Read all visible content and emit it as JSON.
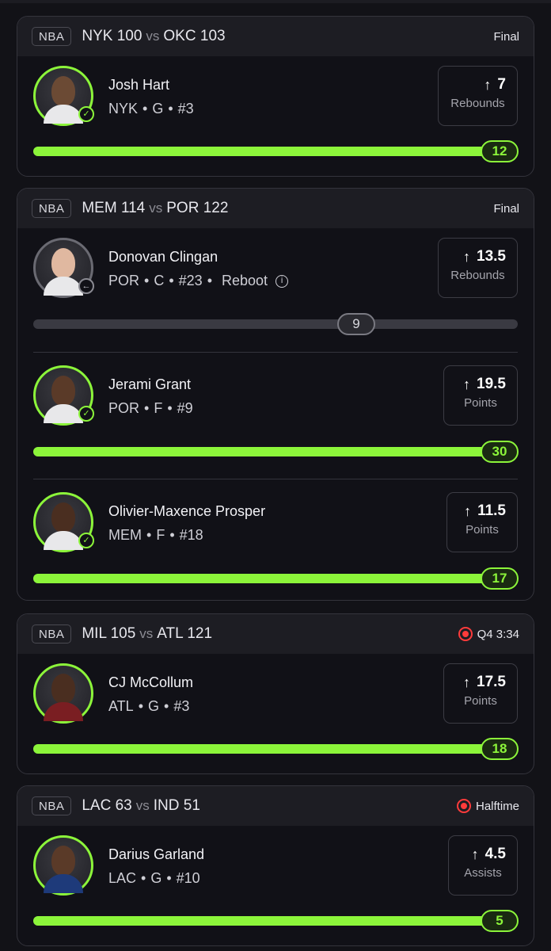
{
  "cards": [
    {
      "league": "NBA",
      "team_a": "NYK",
      "score_a": "100",
      "vs": "vs",
      "team_b": "OKC",
      "score_b": "103",
      "status": "Final",
      "live": false,
      "players": [
        {
          "name": "Josh Hart",
          "team": "NYK",
          "pos": "G",
          "number": "#3",
          "reboot": "",
          "line": "7",
          "category": "Rebounds",
          "actual": "12",
          "progress": 1.0,
          "hit": true
        }
      ]
    },
    {
      "league": "NBA",
      "team_a": "MEM",
      "score_a": "114",
      "vs": "vs",
      "team_b": "POR",
      "score_b": "122",
      "status": "Final",
      "live": false,
      "players": [
        {
          "name": "Donovan Clingan",
          "team": "POR",
          "pos": "C",
          "number": "#23",
          "reboot": "Reboot",
          "line": "13.5",
          "category": "Rebounds",
          "actual": "9",
          "progress": 0.667,
          "hit": false
        },
        {
          "name": "Jerami Grant",
          "team": "POR",
          "pos": "F",
          "number": "#9",
          "reboot": "",
          "line": "19.5",
          "category": "Points",
          "actual": "30",
          "progress": 1.0,
          "hit": true
        },
        {
          "name": "Olivier-Maxence Prosper",
          "team": "MEM",
          "pos": "F",
          "number": "#18",
          "reboot": "",
          "line": "11.5",
          "category": "Points",
          "actual": "17",
          "progress": 1.0,
          "hit": true
        }
      ]
    },
    {
      "league": "NBA",
      "team_a": "MIL",
      "score_a": "105",
      "vs": "vs",
      "team_b": "ATL",
      "score_b": "121",
      "status": "Q4 3:34",
      "live": true,
      "players": [
        {
          "name": "CJ McCollum",
          "team": "ATL",
          "pos": "G",
          "number": "#3",
          "reboot": "",
          "line": "17.5",
          "category": "Points",
          "actual": "18",
          "progress": 1.0,
          "hit": false
        }
      ]
    },
    {
      "league": "NBA",
      "team_a": "LAC",
      "score_a": "63",
      "vs": "vs",
      "team_b": "IND",
      "score_b": "51",
      "status": "Halftime",
      "live": true,
      "players": [
        {
          "name": "Darius Garland",
          "team": "LAC",
          "pos": "G",
          "number": "#10",
          "reboot": "",
          "line": "4.5",
          "category": "Assists",
          "actual": "5",
          "progress": 1.0,
          "hit": false
        }
      ]
    }
  ],
  "colors": {
    "accent": "#8cf53a",
    "live": "#ff3b3b",
    "background": "#121217"
  }
}
